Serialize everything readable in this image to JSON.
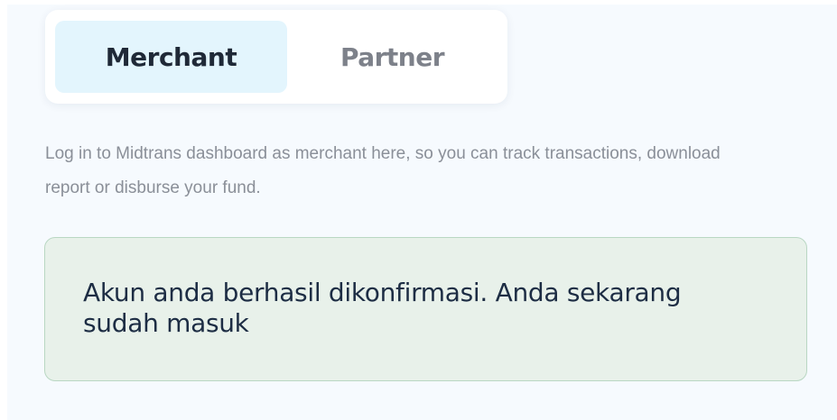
{
  "tabs": {
    "merchant_label": "Merchant",
    "partner_label": "Partner",
    "active": "merchant"
  },
  "description": "Log in to Midtrans dashboard as merchant here, so you can track transactions, download report or disburse your fund.",
  "alert": {
    "message": "Akun anda berhasil dikonfirmasi. Anda sekarang sudah masuk",
    "type": "success"
  },
  "colors": {
    "active_tab_bg": "#e3f5fd",
    "alert_bg": "#e8f1ea",
    "alert_border": "#b9d7c3",
    "panel_bg": "#f6fafe"
  }
}
